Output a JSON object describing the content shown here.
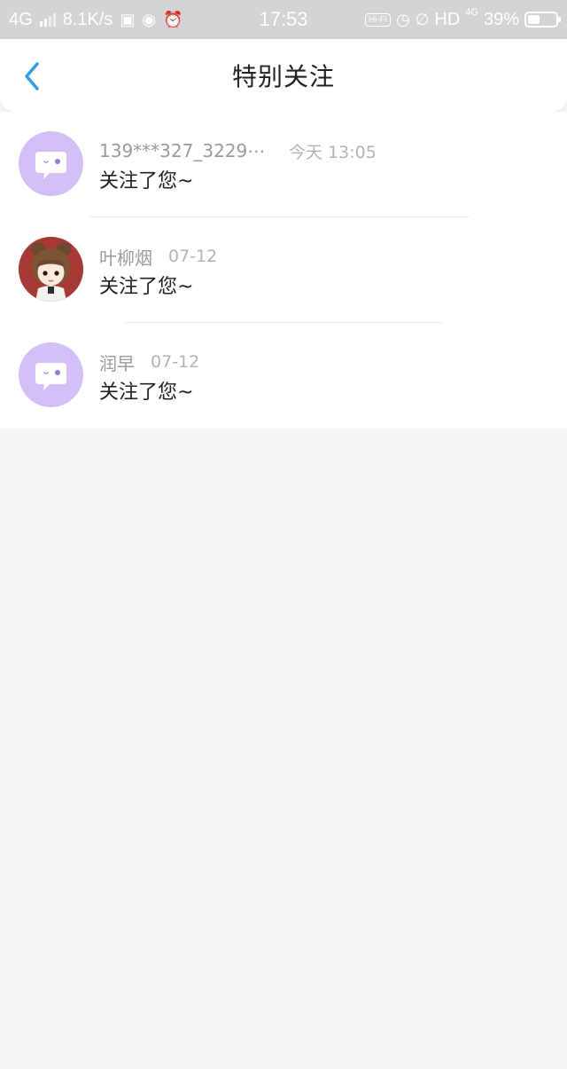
{
  "status_bar": {
    "network": "4G",
    "speed": "8.1K/s",
    "time": "17:53",
    "hifi": "Hi-Fi",
    "hd": "HD",
    "hd_net": "4G",
    "battery": "39%"
  },
  "header": {
    "title": "特别关注",
    "back_icon": "chevron-left-icon",
    "accent": "#2f9fe8"
  },
  "items": [
    {
      "name": "139***327_3229⋯",
      "time": "今天 13:05",
      "message": "关注了您~",
      "avatar": "bot-avatar"
    },
    {
      "name": "叶柳烟",
      "time": "07-12",
      "message": "关注了您~",
      "avatar": "anime-girl-avatar"
    },
    {
      "name": "润早",
      "time": "07-12",
      "message": "关注了您~",
      "avatar": "bot-avatar"
    }
  ]
}
